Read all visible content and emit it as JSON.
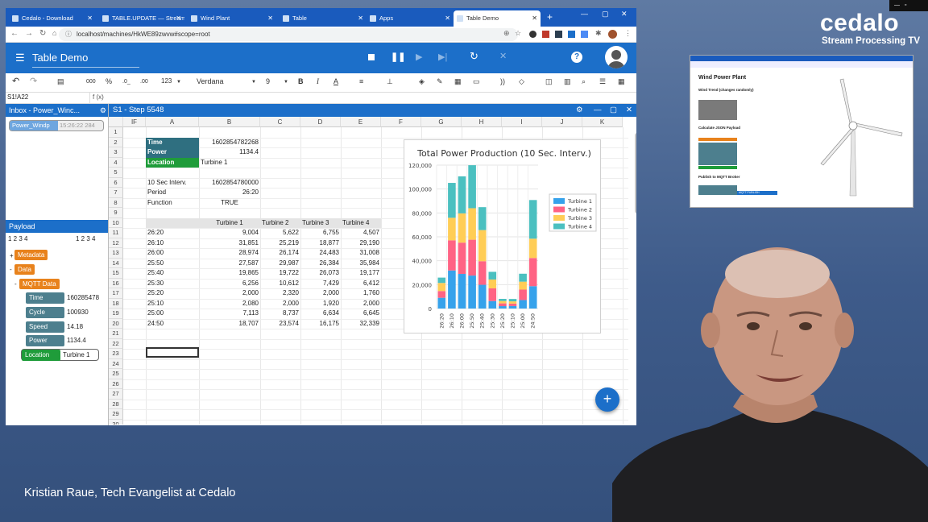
{
  "browser": {
    "tabs": [
      "Cedalo - Download",
      "TABLE.UPDATE — Stream…",
      "Wind Plant",
      "Table",
      "Apps",
      "Table Demo"
    ],
    "new_tab": "+",
    "url": "localhost/machines/HkWE89zwvw#scope=root"
  },
  "app": {
    "title": "Table Demo"
  },
  "toolbar": {
    "number_fmt": "000",
    "percent": "%",
    "dec_minus": ".0_",
    "dec_plus": ".00",
    "num_type": "123",
    "font": "Verdana",
    "size": "9",
    "bold": "B",
    "italic": "I",
    "underline": "A"
  },
  "fx": {
    "cell_ref": "S1!A22",
    "fx_label": "f (x)"
  },
  "inbox": {
    "title": "Inbox - Power_Winc...",
    "item_name": "Power_Windp",
    "item_time": "15:26:22 284"
  },
  "payload": {
    "title": "Payload",
    "nums_left": "1 2 3 4",
    "nums_right": "1 2 3 4",
    "metadata": "Metadata",
    "data": "Data",
    "mqtt": "MQTT Data",
    "fields": [
      {
        "k": "Time",
        "v": "160285478"
      },
      {
        "k": "Cycle",
        "v": "100930"
      },
      {
        "k": "Speed",
        "v": "14.18"
      },
      {
        "k": "Power",
        "v": "1134.4"
      },
      {
        "k": "Location",
        "v": "Turbine 1"
      }
    ]
  },
  "sheet": {
    "title": "S1 - Step 5548",
    "columns": [
      "IF",
      "A",
      "B",
      "C",
      "D",
      "E",
      "F",
      "G",
      "H",
      "I",
      "J",
      "K"
    ],
    "rows": [
      "1",
      "2",
      "3",
      "4",
      "5",
      "6",
      "7",
      "8",
      "9",
      "10",
      "11",
      "12",
      "13",
      "14",
      "15",
      "16",
      "17",
      "18",
      "19",
      "20",
      "21",
      "22",
      "23",
      "24",
      "25",
      "26",
      "27",
      "28",
      "29",
      "30"
    ],
    "info": [
      {
        "k": "Time",
        "v": "1602854782268"
      },
      {
        "k": "Power",
        "v": "1134.4"
      },
      {
        "k": "Location",
        "v": "Turbine 1"
      }
    ],
    "params": [
      {
        "k": "10 Sec Interv.",
        "v": "1602854780000"
      },
      {
        "k": "Period",
        "v": "26:20"
      },
      {
        "k": "Function",
        "v": "TRUE"
      }
    ],
    "table_header": [
      "",
      "Turbine 1",
      "Turbine 2",
      "Turbine 3",
      "Turbine 4"
    ],
    "table": [
      [
        "26:20",
        "9,004",
        "5,622",
        "6,755",
        "4,507"
      ],
      [
        "26:10",
        "31,851",
        "25,219",
        "18,877",
        "29,190"
      ],
      [
        "26:00",
        "28,974",
        "26,174",
        "24,483",
        "31,008"
      ],
      [
        "25:50",
        "27,587",
        "29,987",
        "26,384",
        "35,984"
      ],
      [
        "25:40",
        "19,865",
        "19,722",
        "26,073",
        "19,177"
      ],
      [
        "25:30",
        "6,256",
        "10,612",
        "7,429",
        "6,412"
      ],
      [
        "25:20",
        "2,000",
        "2,320",
        "2,000",
        "1,760"
      ],
      [
        "25:10",
        "2,080",
        "2,000",
        "1,920",
        "2,000"
      ],
      [
        "25:00",
        "7,113",
        "8,737",
        "6,634",
        "6,645"
      ],
      [
        "24:50",
        "18,707",
        "23,574",
        "16,175",
        "32,339"
      ]
    ]
  },
  "chart_data": {
    "type": "bar",
    "stacked": true,
    "title": "Total Power Production (10 Sec. Interv.)",
    "categories": [
      "26:20",
      "26:10",
      "26:00",
      "25:50",
      "25:40",
      "25:30",
      "25:20",
      "25:10",
      "25:00",
      "24:50"
    ],
    "series": [
      {
        "name": "Turbine 1",
        "color": "#36a2eb",
        "values": [
          9004,
          31851,
          28974,
          27587,
          19865,
          6256,
          2000,
          2080,
          7113,
          18707
        ]
      },
      {
        "name": "Turbine 2",
        "color": "#ff6384",
        "values": [
          5622,
          25219,
          26174,
          29987,
          19722,
          10612,
          2320,
          2000,
          8737,
          23574
        ]
      },
      {
        "name": "Turbine 3",
        "color": "#ffcd56",
        "values": [
          6755,
          18877,
          24483,
          26384,
          26073,
          7429,
          2000,
          1920,
          6634,
          16175
        ]
      },
      {
        "name": "Turbine 4",
        "color": "#4bc0c0",
        "values": [
          4507,
          29190,
          31008,
          35984,
          19177,
          6412,
          1760,
          2000,
          6645,
          32339
        ]
      }
    ],
    "yticks": [
      "0",
      "20,000",
      "40,000",
      "60,000",
      "80,000",
      "100,000",
      "120,000"
    ],
    "ylim": [
      0,
      120000
    ],
    "legend": "right",
    "grid": true
  },
  "fab": "+",
  "brand": {
    "logo": "cedalo",
    "tagline": "Stream Processing TV"
  },
  "wind": {
    "title": "Wind Power Plant",
    "subtitle": "Wind Trend (changes randomly)",
    "calc": "Calculate JSON Payload",
    "publish": "Publish to MQTT Broker",
    "publish_btn": "MQTT.PUBLISH"
  },
  "caption": "Kristian Raue, Tech Evangelist at Cedalo"
}
